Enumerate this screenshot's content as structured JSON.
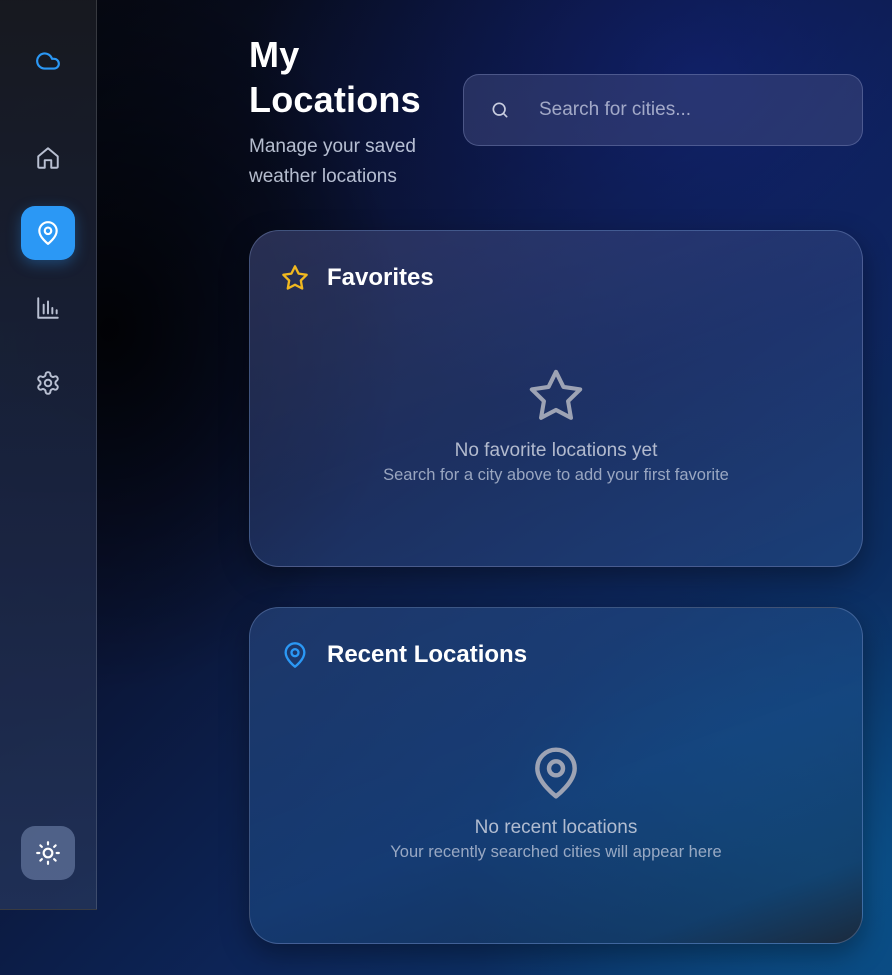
{
  "colors": {
    "accent": "#2b98f5",
    "star": "#f1b81f",
    "pin": "#2b98f5"
  },
  "sidebar": {
    "logo_icon": "cloud-icon",
    "items": [
      {
        "name": "home",
        "icon": "home-icon",
        "active": false
      },
      {
        "name": "locations",
        "icon": "map-pin-icon",
        "active": true
      },
      {
        "name": "stats",
        "icon": "bar-chart-icon",
        "active": false
      },
      {
        "name": "settings",
        "icon": "gear-icon",
        "active": false
      }
    ],
    "theme_toggle_icon": "sun-icon"
  },
  "header": {
    "title": "My Locations",
    "subtitle": "Manage your saved weather locations"
  },
  "search": {
    "icon": "search-icon",
    "placeholder": "Search for cities...",
    "value": ""
  },
  "favorites": {
    "icon": "star-icon",
    "heading": "Favorites",
    "empty_icon": "star-outline-icon",
    "empty_title": "No favorite locations yet",
    "empty_hint": "Search for a city above to add your first favorite"
  },
  "recent": {
    "icon": "map-pin-icon",
    "heading": "Recent Locations",
    "empty_icon": "map-pin-outline-icon",
    "empty_title": "No recent locations",
    "empty_hint": "Your recently searched cities will appear here"
  }
}
